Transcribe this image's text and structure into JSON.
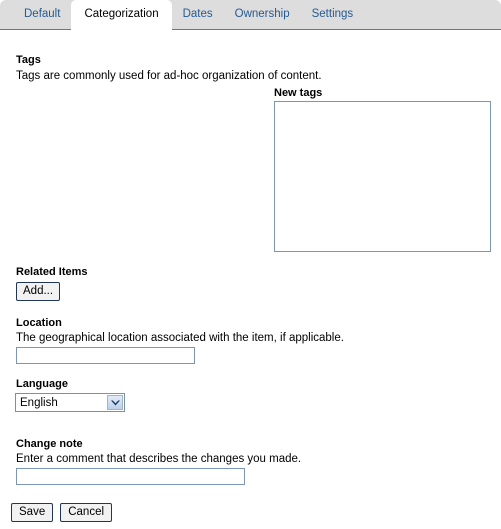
{
  "tabs": [
    {
      "label": "Default",
      "active": false
    },
    {
      "label": "Categorization",
      "active": true
    },
    {
      "label": "Dates",
      "active": false
    },
    {
      "label": "Ownership",
      "active": false
    },
    {
      "label": "Settings",
      "active": false
    }
  ],
  "form": {
    "tags": {
      "label": "Tags",
      "description": "Tags are commonly used for ad-hoc organization of content.",
      "new_tags_label": "New tags",
      "new_tags_value": "",
      "new_tags_placeholder": ""
    },
    "related_items": {
      "label": "Related Items",
      "add_button_label": "Add..."
    },
    "location": {
      "label": "Location",
      "description": "The geographical location associated with the item, if applicable.",
      "value": "",
      "placeholder": ""
    },
    "language": {
      "label": "Language",
      "selected": "English",
      "options": [
        "English"
      ],
      "arrow_icon": "chevron-down-icon"
    },
    "change_note": {
      "label": "Change note",
      "description": "Enter a comment that describes the changes you made.",
      "value": "",
      "placeholder": ""
    }
  },
  "actions": {
    "save_label": "Save",
    "cancel_label": "Cancel"
  },
  "colors": {
    "tabbar_background": "#dddddd",
    "tab_link": "#255b93",
    "tab_active_background": "#ffffff",
    "tabbar_underline": "#757575",
    "input_border": "#7b96b8",
    "button_border": "#22355b",
    "button_background": "#f2f2f2",
    "select_arrow_fill": "#bcd0ea",
    "page_background": "#ffffff"
  }
}
